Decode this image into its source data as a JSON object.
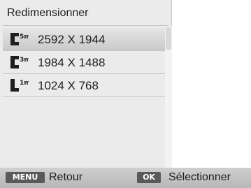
{
  "menu": {
    "title": "Redimensionner",
    "selected_index": 0,
    "options": [
      {
        "label": "2592 X 1944",
        "icon": "resize-5m-icon",
        "icon_glyph": "5m"
      },
      {
        "label": "1984 X 1488",
        "icon": "resize-3m-icon",
        "icon_glyph": "3m"
      },
      {
        "label": "1024 X 768",
        "icon": "resize-1m-icon",
        "icon_glyph": "1m"
      }
    ]
  },
  "footer": {
    "menu_key": "MENU",
    "back_label": "Retour",
    "ok_key": "OK",
    "select_label": "Sélectionner"
  },
  "colors": {
    "panel_bg": "#ebebeb",
    "selected_bg": "#c9c9c9",
    "footer_bg": "#c2c2c2",
    "key_badge": "#595959"
  }
}
